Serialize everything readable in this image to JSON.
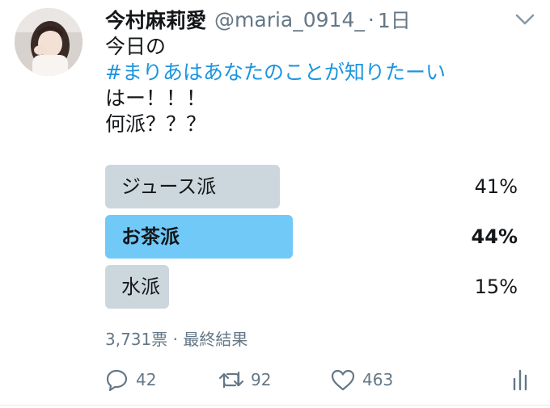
{
  "tweet": {
    "author_name": "今村麻莉愛",
    "handle": "@maria_0914_",
    "separator": "·",
    "time": "1日",
    "lines": [
      {
        "text": "今日の",
        "kind": "plain"
      },
      {
        "text": "#まりあはあなたのことが知りたーい",
        "kind": "hashtag"
      },
      {
        "text": "はー！！！",
        "kind": "plain"
      },
      {
        "text": "何派？？？",
        "kind": "plain"
      }
    ]
  },
  "poll": {
    "options": [
      {
        "label": "ジュース派",
        "percent_text": "41%",
        "percent": 41,
        "winner": false
      },
      {
        "label": "お茶派",
        "percent_text": "44%",
        "percent": 44,
        "winner": true
      },
      {
        "label": "水派",
        "percent_text": "15%",
        "percent": 15,
        "winner": false
      }
    ],
    "meta": "3,731票 · 最終結果"
  },
  "actions": {
    "reply_count": "42",
    "retweet_count": "92",
    "like_count": "463"
  },
  "icons": {
    "caret": "chevron-down-icon",
    "reply": "reply-icon",
    "retweet": "retweet-icon",
    "like": "heart-icon",
    "analytics": "analytics-icon"
  },
  "colors": {
    "text": "#14171a",
    "secondary": "#657786",
    "link": "#1b95e0",
    "poll_bar": "#ccd6dd",
    "poll_winner": "#71c9f8"
  }
}
